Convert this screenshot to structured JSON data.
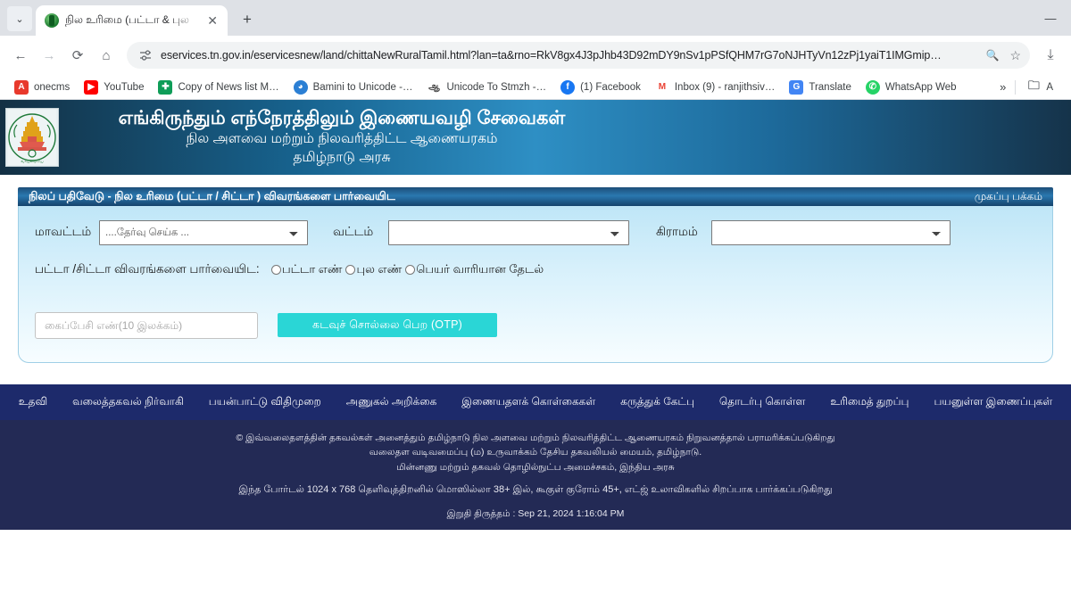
{
  "browser": {
    "tab": {
      "title": "நில உரிமை (பட்டா & புல",
      "close_label": "✕"
    },
    "new_tab_label": "+",
    "tab_list_label": "⌄",
    "window": {
      "minimize": "—"
    },
    "nav": {
      "back": "←",
      "forward": "→",
      "reload": "⟳",
      "home": "⌂"
    },
    "omnibox": {
      "url": "eservices.tn.gov.in/eservicesnew/land/chittaNewRuralTamil.html?lan=ta&rno=RkV8gx4J3pJhb43D92mDY9nSv1pPSfQHM7rG7oNJHTyVn12zPj1yaiT1IMGmip…",
      "site_icon": "page-settings-icon",
      "zoom_icon": "🔍",
      "bookmark_icon": "☆"
    },
    "toolbar_right": {
      "download_icon": "⤓"
    },
    "bookmarks": [
      {
        "label": "onecms",
        "icon": "A",
        "color": "#e8392c"
      },
      {
        "label": "YouTube",
        "icon": "▶",
        "color": "#ff0000"
      },
      {
        "label": "Copy of News list M…",
        "icon": "✚",
        "color": "#0f9d58"
      },
      {
        "label": "Bamini to Unicode -…",
        "icon": "◕",
        "color": "#2b7fd4"
      },
      {
        "label": "Unicode To Stmzh -…",
        "icon": "ஆ",
        "color": "#3a3a3a"
      },
      {
        "label": "(1) Facebook",
        "icon": "f",
        "color": "#1877f2"
      },
      {
        "label": "Inbox (9) - ranjithsiv…",
        "icon": "M",
        "color": "#ea4335"
      },
      {
        "label": "Translate",
        "icon": "G",
        "color": "#4285f4"
      },
      {
        "label": "WhatsApp Web",
        "icon": "✆",
        "color": "#25d366"
      }
    ],
    "bookmarks_overflow": "»",
    "bookmarks_folder_label": "A"
  },
  "gov_header": {
    "line1": "எங்கிருந்தும் எந்நேரத்திலும் இணையவழி சேவைகள்",
    "line2": "நில அளவை மற்றும் நிலவரித்திட்ட ஆணையரகம்",
    "line3": "தமிழ்நாடு அரசு",
    "emblem_name": "tamil-nadu-state-emblem"
  },
  "panel": {
    "title": "நிலப் பதிவேடு - நில உரிமை (பட்டா / சிட்டா ) விவரங்களை பார்வையிட",
    "home_link": "முகப்பு பக்கம்"
  },
  "form": {
    "district_label": "மாவட்டம்",
    "district_value": "....தேர்வு செய்க ...",
    "taluk_label": "வட்டம்",
    "taluk_value": "",
    "village_label": "கிராமம்",
    "village_value": "",
    "view_label": "பட்டா /சிட்டா விவரங்களை பார்வையிட:",
    "radio_options": [
      "பட்டா எண்",
      "புல எண்",
      "பெயர் வாரியான தேடல்"
    ],
    "mobile_placeholder": "கைப்பேசி எண்(10 இலக்கம்)",
    "mobile_value": "",
    "otp_button": "கடவுச் சொல்லை பெற (OTP)",
    "accent_color": "#2ad6d6"
  },
  "footer": {
    "links": [
      "உதவி",
      "வலைத்தகவல் நிர்வாகி",
      "பயன்பாட்டு விதிமுறை",
      "அணுகல் அறிக்கை",
      "இணையதளக் கொள்கைகள்",
      "கருத்துக் கேட்பு",
      "தொடர்பு கொள்ள",
      "உரிமைத் துறப்பு",
      "பயனுள்ள இணைப்புகள்"
    ],
    "copyright_line1": "© இவ்வலைதளத்தின் தகவல்கள் அனைத்தும் தமிழ்நாடு நில அளவை மற்றும் நிலவரித்திட்ட ஆணையரகம் நிறுவனத்தால் பராமரிக்கப்படுகிறது",
    "copyright_line2": "வலைதள வடிவமைப்பு (ம) உருவாக்கம் தேசிய தகவலியல் மையம், தமிழ்நாடு.",
    "copyright_line3": "மின்னணு மற்றும் தகவல் தொழில்நுட்ப அமைச்சகம், இந்திய அரசு",
    "browser_note": "இந்த போர்டல் 1024 x 768 தெளிவுத்திறனில் மொஸில்லா 38+ இல், கூகுள் குரோம் 45+, எட்ஜ் உலாவிகளில் சிறப்பாக பார்க்கப்படுகிறது",
    "last_updated": "இறுதி திருத்தம் : Sep 21, 2024 1:16:04 PM"
  }
}
